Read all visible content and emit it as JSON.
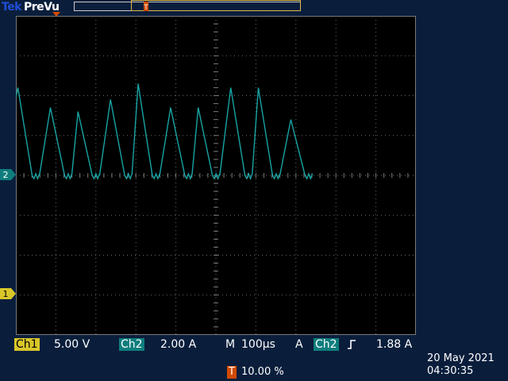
{
  "header": {
    "brand_tek": "Tek",
    "brand_mode": "PreVu"
  },
  "trigger_marker": {
    "letter": "T"
  },
  "channels": {
    "ch1_marker": "1",
    "ch2_marker": "2",
    "ch1_name": "Ch1",
    "ch1_scale": "5.00 V",
    "ch2_name": "Ch2",
    "ch2_scale": "2.00 A"
  },
  "timebase": {
    "mode": "M",
    "scale": "100µs"
  },
  "trigger": {
    "mode": "A",
    "source": "Ch2",
    "slope_icon": "rising-edge-icon",
    "level": "1.88 A",
    "position_label": "T",
    "position": "10.00 %"
  },
  "datetime": {
    "date": "20 May 2021",
    "time": "04:30:35"
  },
  "colors": {
    "trace": "#18a4a4",
    "ch1": "#d8c62a",
    "ch2": "#0f7d7d",
    "trigger": "#d24a00",
    "background": "#0a1e3c"
  },
  "waveform": {
    "channel": "Ch2",
    "shape": "sawtooth",
    "baseline_divs_from_top": 4.0,
    "peaks_divs_above_baseline": [
      2.2,
      1.7,
      1.6,
      1.9,
      2.3,
      1.7,
      1.7,
      2.2,
      2.2,
      1.4
    ]
  }
}
